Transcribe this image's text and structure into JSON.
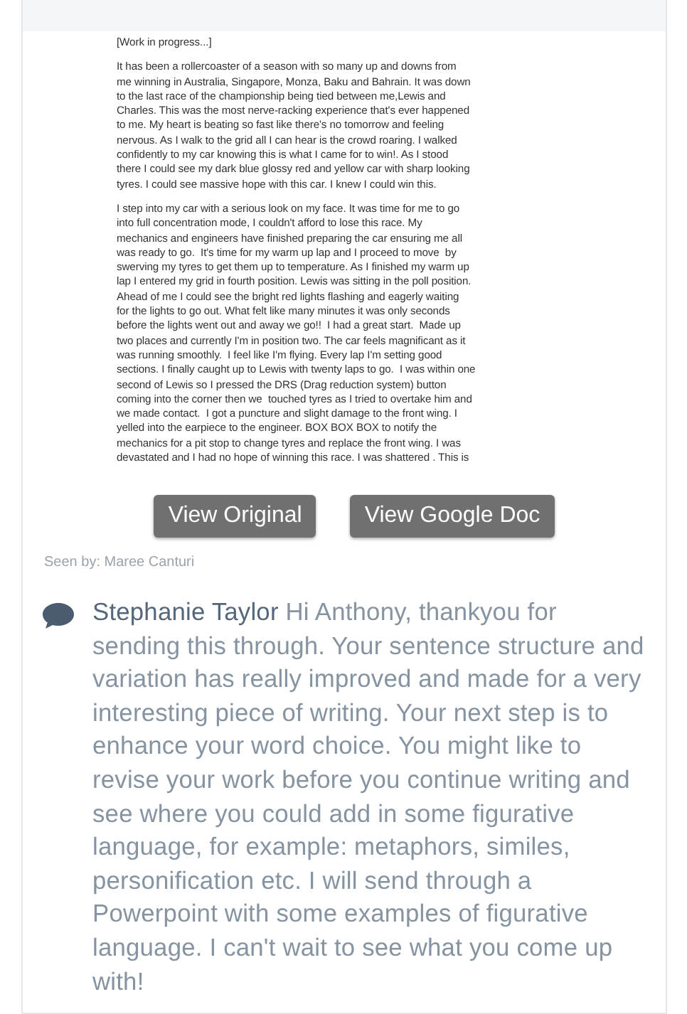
{
  "document": {
    "paragraphs": [
      "[Work in progress...]",
      "It has been a rollercoaster of a season with so many up and downs from\nme winning in Australia, Singapore, Monza, Baku and Bahrain. It was down\nto the last race of the championship being tied between me,Lewis and\nCharles. This was the most nerve-racking experience that's ever happened\nto me. My heart is beating so fast like there's no tomorrow and feeling\nnervous. As I walk to the grid all I can hear is the crowd roaring. I walked\nconfidently to my car knowing this is what I came for to win!. As I stood\nthere I could see my dark blue glossy red and yellow car with sharp looking\ntyres. I could see massive hope with this car. I knew I could win this.",
      "I step into my car with a serious look on my face. It was time for me to go\ninto full concentration mode, I couldn't afford to lose this race. My\nmechanics and engineers have finished preparing the car ensuring me all\nwas ready to go.  It's time for my warm up lap and I proceed to move  by\nswerving my tyres to get them up to temperature. As I finished my warm up\nlap I entered my grid in fourth position. Lewis was sitting in the poll position.\nAhead of me I could see the bright red lights flashing and eagerly waiting\nfor the lights to go out. What felt like many minutes it was only seconds\nbefore the lights went out and away we go!!  I had a great start.  Made up\ntwo places and currently I'm in position two. The car feels magnificant as it\nwas running smoothly.  I feel like I'm flying. Every lap I'm setting good\nsections. I finally caught up to Lewis with twenty laps to go.  I was within one\nsecond of Lewis so I pressed the DRS (Drag reduction system) button\ncoming into the corner then we  touched tyres as I tried to overtake him and\nwe made contact.  I got a puncture and slight damage to the front wing. I\nyelled into the earpiece to the engineer. BOX BOX BOX to notify the\nmechanics for a pit stop to change tyres and replace the front wing. I was\ndevastated and I had no hope of winning this race. I was shattered . This is"
    ]
  },
  "buttons": [
    "View Original",
    "View Google Doc"
  ],
  "seen_by": "Seen by: Maree Canturi",
  "comment": {
    "author": "Stephanie Taylor",
    "text": "Hi Anthony, thankyou for sending this through. Your sentence structure and variation has really improved and made for a very interesting piece of writing. Your next step is to enhance your word choice. You might like to revise your work before you continue writing and see where you could add in some figurative language, for example: metaphors, similes, personification etc. I will send through a Powerpoint with some examples of figurative language. I can't wait to see what you come up with!"
  }
}
